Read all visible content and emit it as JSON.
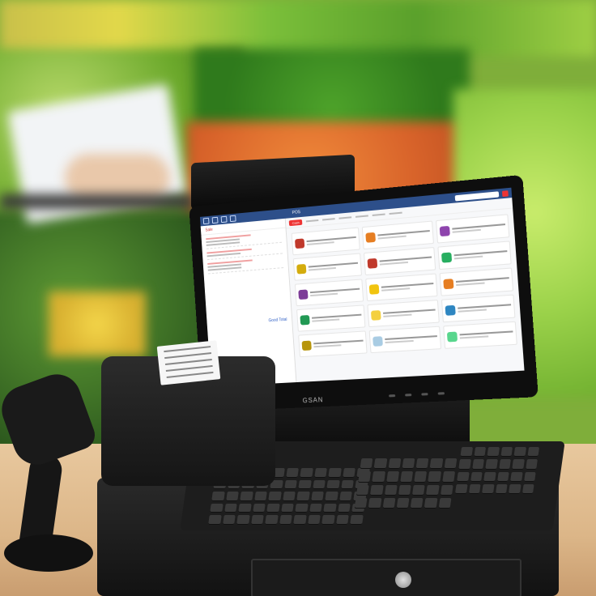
{
  "image": {
    "description_objects": [
      "produce-background",
      "pos-terminal",
      "receipt-printer",
      "barcode-scanner",
      "cash-drawer",
      "keyboard",
      "customer-display"
    ]
  },
  "pos_screen": {
    "brand": "GSAN",
    "topbar_title": "POS",
    "left_pane_header": "Sale",
    "total_label": "Good Total",
    "cash_tab": "Cash",
    "item_colors": [
      "#c0392b",
      "#e67e22",
      "#8e44ad",
      "#d4ac0d",
      "#c0392b",
      "#27ae60",
      "#7d3c98",
      "#f1c40f",
      "#e67e22",
      "#229954",
      "#f4d03f",
      "#2e86c1",
      "#b7950b",
      "#a9cce3",
      "#58d68d"
    ]
  }
}
